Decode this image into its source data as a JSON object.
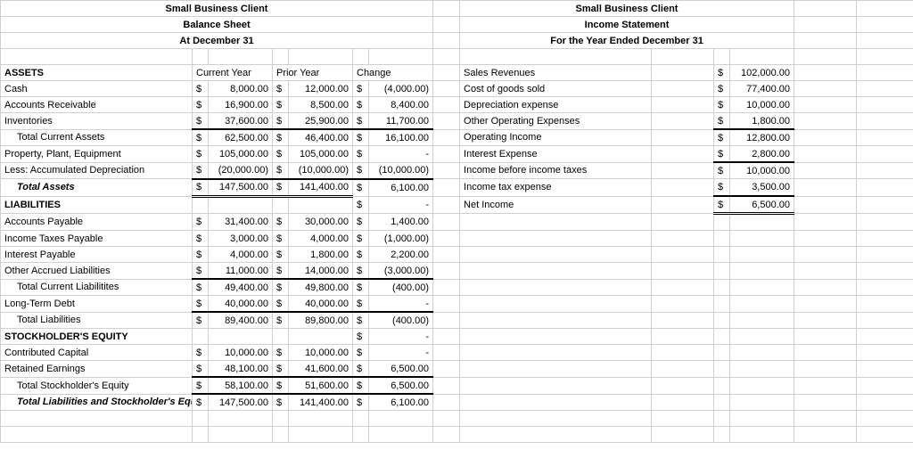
{
  "left": {
    "title1": "Small Business Client",
    "title2": "Balance Sheet",
    "title3": "At December 31",
    "headers": {
      "h_assets": "ASSETS",
      "c1": "Current Year",
      "c2": "Prior Year",
      "c3": "Change"
    },
    "rows": [
      {
        "label": "Cash",
        "cy": "8,000.00",
        "py": "12,000.00",
        "ch": "(4,000.00)"
      },
      {
        "label": "Accounts Receivable",
        "cy": "16,900.00",
        "py": "8,500.00",
        "ch": "8,400.00"
      },
      {
        "label": "Inventories",
        "cy": "37,600.00",
        "py": "25,900.00",
        "ch": "11,700.00"
      },
      {
        "label": "Total Current Assets",
        "indent": true,
        "topline": true,
        "cy": "62,500.00",
        "py": "46,400.00",
        "ch": "16,100.00"
      },
      {
        "label": "Property, Plant, Equipment",
        "cy": "105,000.00",
        "py": "105,000.00",
        "ch": "-"
      },
      {
        "label": "Less: Accumulated Depreciation",
        "cy": "(20,000.00)",
        "py": "(10,000.00)",
        "ch": "(10,000.00)"
      },
      {
        "label": "Total Assets",
        "indent": true,
        "bi": true,
        "topline": true,
        "dbl": true,
        "cy": "147,500.00",
        "py": "141,400.00",
        "ch": "6,100.00"
      }
    ],
    "liab_header": "LIABILITIES",
    "liab_spacer_ch": "-",
    "liab_rows": [
      {
        "label": "Accounts Payable",
        "cy": "31,400.00",
        "py": "30,000.00",
        "ch": "1,400.00"
      },
      {
        "label": "Income Taxes Payable",
        "cy": "3,000.00",
        "py": "4,000.00",
        "ch": "(1,000.00)"
      },
      {
        "label": "Interest Payable",
        "cy": "4,000.00",
        "py": "1,800.00",
        "ch": "2,200.00"
      },
      {
        "label": "Other Accrued Liabilities",
        "cy": "11,000.00",
        "py": "14,000.00",
        "ch": "(3,000.00)"
      },
      {
        "label": "Total Current Liabilitites",
        "indent": true,
        "topline": true,
        "cy": "49,400.00",
        "py": "49,800.00",
        "ch": "(400.00)"
      },
      {
        "label": "Long-Term Debt",
        "cy": "40,000.00",
        "py": "40,000.00",
        "ch": "-"
      },
      {
        "label": "Total Liabilities",
        "indent": true,
        "topline": true,
        "cy": "89,400.00",
        "py": "89,800.00",
        "ch": "(400.00)"
      }
    ],
    "eq_header": "STOCKHOLDER'S EQUITY",
    "eq_spacer_ch": "-",
    "eq_rows": [
      {
        "label": "Contributed Capital",
        "cy": "10,000.00",
        "py": "10,000.00",
        "ch": "-"
      },
      {
        "label": "Retained Earnings",
        "cy": "48,100.00",
        "py": "41,600.00",
        "ch": "6,500.00"
      },
      {
        "label": "Total Stockholder's Equity",
        "indent": true,
        "topline": true,
        "cy": "58,100.00",
        "py": "51,600.00",
        "ch": "6,500.00"
      },
      {
        "label": "Total Liabilities and Stockholder's Equity",
        "indent": true,
        "bi": true,
        "topline": true,
        "cy": "147,500.00",
        "py": "141,400.00",
        "ch": "6,100.00"
      }
    ]
  },
  "right": {
    "title1": "Small Business Client",
    "title2": "Income Statement",
    "title3": "For the Year Ended December 31",
    "rows": [
      {
        "label": "Sales Revenues",
        "val": "102,000.00"
      },
      {
        "label": "Cost of goods sold",
        "val": "77,400.00"
      },
      {
        "label": "Depreciation expense",
        "val": "10,000.00"
      },
      {
        "label": "Other Operating Expenses",
        "val": "1,800.00"
      },
      {
        "label": "Operating Income",
        "topline": true,
        "val": "12,800.00"
      },
      {
        "label": "Interest Expense",
        "val": "2,800.00"
      },
      {
        "label": "Income before income taxes",
        "topline": true,
        "val": "10,000.00"
      },
      {
        "label": "Income tax expense",
        "val": "3,500.00"
      },
      {
        "label": "Net Income",
        "topline": true,
        "dbl": true,
        "val": "6,500.00"
      }
    ]
  },
  "chart_data": {
    "type": "table",
    "title": "Small Business Client — Balance Sheet & Income Statement",
    "balance_sheet": {
      "as_of": "December 31",
      "columns": [
        "Current Year",
        "Prior Year",
        "Change"
      ],
      "assets": [
        [
          "Cash",
          8000.0,
          12000.0,
          -4000.0
        ],
        [
          "Accounts Receivable",
          16900.0,
          8500.0,
          8400.0
        ],
        [
          "Inventories",
          37600.0,
          25900.0,
          11700.0
        ],
        [
          "Total Current Assets",
          62500.0,
          46400.0,
          16100.0
        ],
        [
          "Property, Plant, Equipment",
          105000.0,
          105000.0,
          0.0
        ],
        [
          "Less: Accumulated Depreciation",
          -20000.0,
          -10000.0,
          -10000.0
        ],
        [
          "Total Assets",
          147500.0,
          141400.0,
          6100.0
        ]
      ],
      "liabilities": [
        [
          "Accounts Payable",
          31400.0,
          30000.0,
          1400.0
        ],
        [
          "Income Taxes Payable",
          3000.0,
          4000.0,
          -1000.0
        ],
        [
          "Interest Payable",
          4000.0,
          1800.0,
          2200.0
        ],
        [
          "Other Accrued Liabilities",
          11000.0,
          14000.0,
          -3000.0
        ],
        [
          "Total Current Liabilities",
          49400.0,
          49800.0,
          -400.0
        ],
        [
          "Long-Term Debt",
          40000.0,
          40000.0,
          0.0
        ],
        [
          "Total Liabilities",
          89400.0,
          89800.0,
          -400.0
        ]
      ],
      "equity": [
        [
          "Contributed Capital",
          10000.0,
          10000.0,
          0.0
        ],
        [
          "Retained Earnings",
          48100.0,
          41600.0,
          6500.0
        ],
        [
          "Total Stockholder's Equity",
          58100.0,
          51600.0,
          6500.0
        ],
        [
          "Total Liabilities and Stockholder's Equity",
          147500.0,
          141400.0,
          6100.0
        ]
      ]
    },
    "income_statement": {
      "period": "Year Ended December 31",
      "rows": [
        [
          "Sales Revenues",
          102000.0
        ],
        [
          "Cost of goods sold",
          77400.0
        ],
        [
          "Depreciation expense",
          10000.0
        ],
        [
          "Other Operating Expenses",
          1800.0
        ],
        [
          "Operating Income",
          12800.0
        ],
        [
          "Interest Expense",
          2800.0
        ],
        [
          "Income before income taxes",
          10000.0
        ],
        [
          "Income tax expense",
          3500.0
        ],
        [
          "Net Income",
          6500.0
        ]
      ]
    }
  }
}
